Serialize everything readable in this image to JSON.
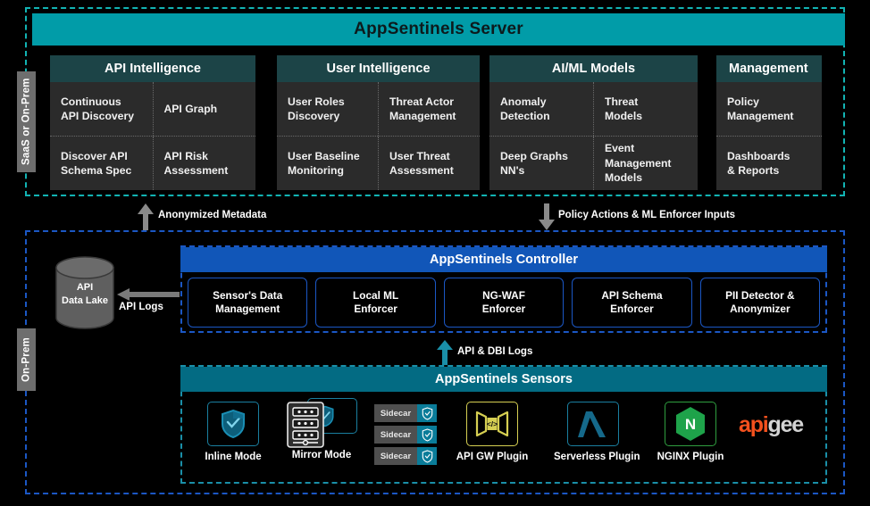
{
  "zones": {
    "saas": {
      "label": "SaaS or On-Prem"
    },
    "onprem": {
      "label": "On-Prem"
    }
  },
  "server": {
    "title": "AppSentinels Server",
    "panels": [
      {
        "title": "API Intelligence",
        "align": "center",
        "rows": [
          [
            "Continuous\nAPI Discovery",
            "API Graph"
          ],
          [
            "Discover API\nSchema Spec",
            "API Risk\nAssessment"
          ]
        ]
      },
      {
        "title": "User Intelligence",
        "align": "center",
        "rows": [
          [
            "User Roles\nDiscovery",
            "Threat Actor\nManagement"
          ],
          [
            "User Baseline\nMonitoring",
            "User Threat\nAssessment"
          ]
        ]
      },
      {
        "title": "AI/ML Models",
        "align": "center",
        "rows": [
          [
            "Anomaly\nDetection",
            "Threat\nModels"
          ],
          [
            "Deep Graphs\nNN's",
            "Event\nManagement\nModels"
          ]
        ]
      },
      {
        "title": "Management",
        "align": "left",
        "rows": [
          [
            "Policy\nManagement"
          ],
          [
            "Dashboards\n& Reports"
          ]
        ]
      }
    ]
  },
  "flows": {
    "up_label": "Anonymized Metadata",
    "down_label": "Policy Actions & ML Enforcer Inputs",
    "api_dbi_label": "API & DBI Logs",
    "api_logs_label": "API Logs"
  },
  "controller": {
    "title": "AppSentinels Controller",
    "items": [
      "Sensor's Data\nManagement",
      "Local ML\nEnforcer",
      "NG-WAF\nEnforcer",
      "API Schema\nEnforcer",
      "PII Detector &\nAnonymizer"
    ]
  },
  "datalake": {
    "label": "API\nData Lake"
  },
  "sensors": {
    "title": "AppSentinels Sensors",
    "items": [
      {
        "caption": "Inline Mode",
        "icon": "shield-in-frame-icon"
      },
      {
        "caption": "Mirror Mode",
        "icon": "server-rack-shield-icon"
      },
      {
        "caption": "",
        "icon": "sidecar-stack-icon"
      },
      {
        "caption": "API GW Plugin",
        "icon": "api-gateway-icon"
      },
      {
        "caption": "Serverless Plugin",
        "icon": "lambda-icon"
      },
      {
        "caption": "NGINX Plugin",
        "icon": "nginx-icon"
      },
      {
        "caption": "",
        "icon": "apigee-logo-icon"
      }
    ],
    "sidecar_labels": [
      "Sidecar",
      "Sidecar",
      "Sidecar"
    ],
    "apigee": {
      "part1": "api",
      "part2": "gee"
    }
  },
  "colors": {
    "teal_banner": "#019ca8",
    "teal_dark_banner": "#036b83",
    "panel_head": "#1c4447",
    "panel_body": "#2b2b2b",
    "blue_banner": "#1156b8",
    "blue_dash": "#1b57c4",
    "teal_dash": "#12b3b3",
    "gold": "#d6cf52",
    "nginx_green": "#1ea34a",
    "apigee_orange": "#f4511e"
  }
}
